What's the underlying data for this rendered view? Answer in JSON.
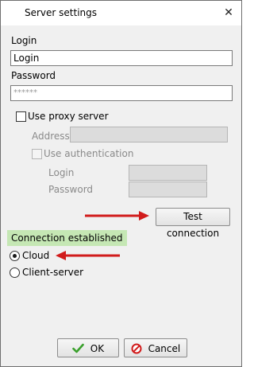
{
  "window": {
    "title": "Server settings",
    "close_glyph": "✕"
  },
  "login": {
    "label": "Login",
    "value": "Login"
  },
  "password": {
    "label": "Password",
    "value": "******"
  },
  "proxy": {
    "use_proxy_label": "Use proxy server",
    "use_proxy_checked": false,
    "address_label": "Address",
    "address_value": "",
    "use_auth_label": "Use authentication",
    "use_auth_checked": false,
    "auth_login_label": "Login",
    "auth_password_label": "Password"
  },
  "test_button_label": "Test connection",
  "status": {
    "text": "Connection established",
    "color": "#c5e7b4"
  },
  "connection_type": {
    "options": [
      "Cloud",
      "Client-server"
    ],
    "selected": "Cloud"
  },
  "footer": {
    "ok_label": "OK",
    "cancel_label": "Cancel"
  },
  "annotations": {
    "arrow_color": "#d11b1b",
    "icons": [
      "check-icon",
      "cancel-icon",
      "red-arrow"
    ]
  }
}
